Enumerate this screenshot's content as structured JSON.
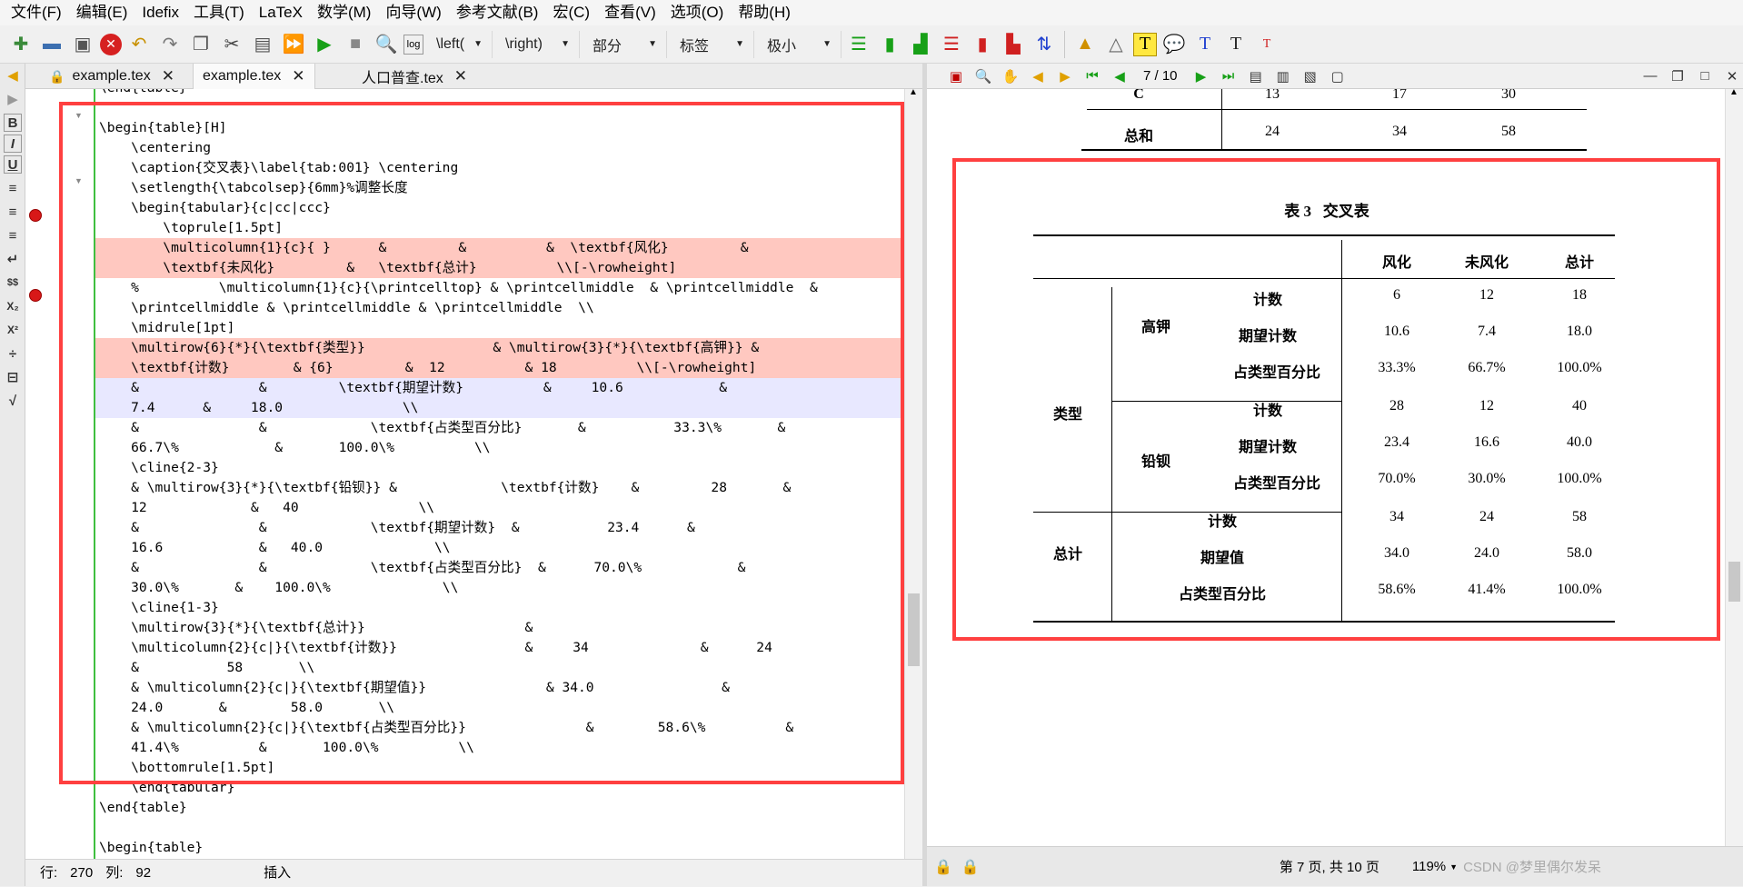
{
  "menu": [
    "文件(F)",
    "编辑(E)",
    "Idefix",
    "工具(T)",
    "LaTeX",
    "数学(M)",
    "向导(W)",
    "参考文献(B)",
    "宏(C)",
    "查看(V)",
    "选项(O)",
    "帮助(H)"
  ],
  "toolbar": {
    "dropdowns": [
      "\\left(",
      "\\right)",
      "部分",
      "标签",
      "极小"
    ]
  },
  "tabs": [
    {
      "label": "example.tex",
      "locked": true,
      "close": "✕"
    },
    {
      "label": "example.tex",
      "locked": false,
      "close": "✕"
    },
    {
      "label": "人口普查.tex",
      "locked": false,
      "close": "✕"
    }
  ],
  "editor": {
    "lines": [
      {
        "text": "\\end{table}",
        "hl": ""
      },
      {
        "text": "",
        "hl": ""
      },
      {
        "text": "\\begin{table}[H]",
        "hl": ""
      },
      {
        "text": "    \\centering",
        "hl": ""
      },
      {
        "text": "    \\caption{交叉表}\\label{tab:001} \\centering",
        "hl": ""
      },
      {
        "text": "    \\setlength{\\tabcolsep}{6mm}%调整长度",
        "hl": ""
      },
      {
        "text": "    \\begin{tabular}{c|cc|ccc}",
        "hl": ""
      },
      {
        "text": "        \\toprule[1.5pt]",
        "hl": ""
      },
      {
        "text": "        \\multicolumn{1}{c}{ }      &         &          &  \\textbf{风化}         &",
        "hl": "red"
      },
      {
        "text": "        \\textbf{未风化}         &   \\textbf{总计}          \\\\[-\\rowheight]",
        "hl": "red"
      },
      {
        "text": "    %          \\multicolumn{1}{c}{\\printcelltop} & \\printcellmiddle  & \\printcellmiddle  &",
        "hl": ""
      },
      {
        "text": "    \\printcellmiddle & \\printcellmiddle & \\printcellmiddle  \\\\",
        "hl": ""
      },
      {
        "text": "    \\midrule[1pt]",
        "hl": ""
      },
      {
        "text": "    \\multirow{6}{*}{\\textbf{类型}}                & \\multirow{3}{*}{\\textbf{高钾}} &",
        "hl": "red"
      },
      {
        "text": "    \\textbf{计数}        & {6}         &  12          & 18          \\\\[-\\rowheight]",
        "hl": "red"
      },
      {
        "text": "    &               &         \\textbf{期望计数}          &     10.6            &",
        "hl": "blue"
      },
      {
        "text": "    7.4      &     18.0               \\\\",
        "hl": "blue"
      },
      {
        "text": "    &               &             \\textbf{占类型百分比}       &           33.3\\%       &",
        "hl": ""
      },
      {
        "text": "    66.7\\%            &       100.0\\%          \\\\",
        "hl": ""
      },
      {
        "text": "    \\cline{2-3}",
        "hl": ""
      },
      {
        "text": "    & \\multirow{3}{*}{\\textbf{铅钡}} &             \\textbf{计数}    &         28       &",
        "hl": ""
      },
      {
        "text": "    12             &   40               \\\\",
        "hl": ""
      },
      {
        "text": "    &               &             \\textbf{期望计数}  &           23.4      &",
        "hl": ""
      },
      {
        "text": "    16.6            &   40.0              \\\\",
        "hl": ""
      },
      {
        "text": "    &               &             \\textbf{占类型百分比}  &      70.0\\%            &",
        "hl": ""
      },
      {
        "text": "    30.0\\%       &    100.0\\%              \\\\",
        "hl": ""
      },
      {
        "text": "    \\cline{1-3}",
        "hl": ""
      },
      {
        "text": "    \\multirow{3}{*}{\\textbf{总计}}                    &",
        "hl": ""
      },
      {
        "text": "    \\multicolumn{2}{c|}{\\textbf{计数}}                &     34              &      24",
        "hl": ""
      },
      {
        "text": "    &           58       \\\\",
        "hl": ""
      },
      {
        "text": "    & \\multicolumn{2}{c|}{\\textbf{期望值}}               & 34.0                &",
        "hl": ""
      },
      {
        "text": "    24.0       &        58.0       \\\\",
        "hl": ""
      },
      {
        "text": "    & \\multicolumn{2}{c|}{\\textbf{占类型百分比}}               &        58.6\\%          &",
        "hl": ""
      },
      {
        "text": "    41.4\\%          &       100.0\\%          \\\\",
        "hl": ""
      },
      {
        "text": "    \\bottomrule[1.5pt]",
        "hl": ""
      },
      {
        "text": "    \\end{tabular}",
        "hl": ""
      },
      {
        "text": "\\end{table}",
        "hl": ""
      },
      {
        "text": "",
        "hl": ""
      },
      {
        "text": "\\begin{table}",
        "hl": ""
      }
    ],
    "status": {
      "line_label": "行:",
      "line": "270",
      "col_label": "列:",
      "col": "92",
      "mode": "插入"
    }
  },
  "viewer": {
    "page_indicator": "7 / 10",
    "prev_table": {
      "rows": [
        {
          "label": "C",
          "values": [
            "13",
            "17",
            "30"
          ]
        },
        {
          "label": "总和",
          "values": [
            "24",
            "34",
            "58"
          ]
        }
      ]
    },
    "caption": {
      "num": "表 3",
      "title": "交叉表"
    },
    "headers": [
      "风化",
      "未风化",
      "总计"
    ],
    "groups": {
      "type": "类型",
      "k": "高钾",
      "pb": "铅钡",
      "total": "总计"
    },
    "row_labels": {
      "count": "计数",
      "expected": "期望计数",
      "percent": "占类型百分比",
      "expected_value": "期望值"
    },
    "rows": {
      "k_count": [
        "6",
        "12",
        "18"
      ],
      "k_expected": [
        "10.6",
        "7.4",
        "18.0"
      ],
      "k_percent": [
        "33.3%",
        "66.7%",
        "100.0%"
      ],
      "pb_count": [
        "28",
        "12",
        "40"
      ],
      "pb_expected": [
        "23.4",
        "16.6",
        "40.0"
      ],
      "pb_percent": [
        "70.0%",
        "30.0%",
        "100.0%"
      ],
      "t_count": [
        "34",
        "24",
        "58"
      ],
      "t_expected": [
        "34.0",
        "24.0",
        "58.0"
      ],
      "t_percent": [
        "58.6%",
        "41.4%",
        "100.0%"
      ]
    },
    "status": {
      "page_text": "第 7 页, 共 10 页",
      "zoom": "119%",
      "watermark": "CSDN @梦里偶尔发呆"
    }
  },
  "colors": {
    "highlight_box": "#ff4040",
    "error_line": "#ffc8c0",
    "cursor_line": "#e8e8ff",
    "change_bar": "#3fbf3f"
  }
}
